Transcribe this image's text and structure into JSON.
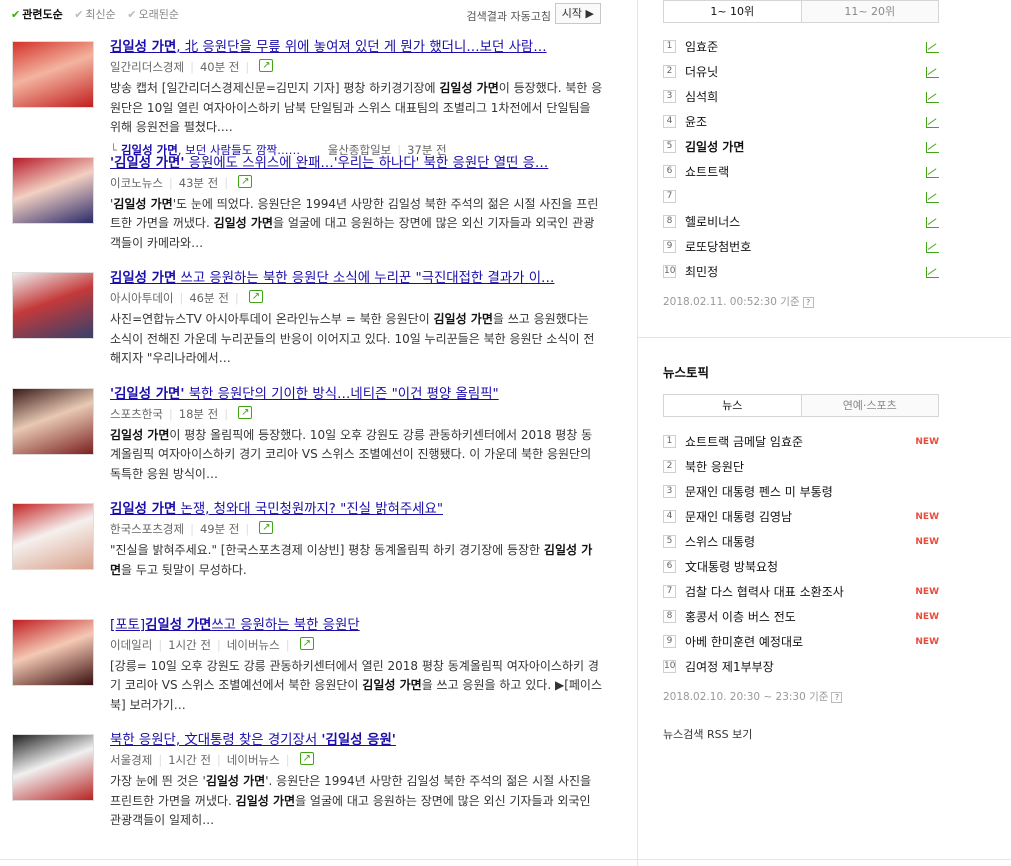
{
  "sort": {
    "options": [
      "관련도순",
      "최신순",
      "오래된순"
    ],
    "auto_label": "검색결과 자동고침",
    "start_label": "시작"
  },
  "articles": [
    {
      "title_parts": [
        {
          "t": "김일성 가면",
          "b": true
        },
        {
          "t": ", 北 응원단을 무릎 위에 놓여져 있던 게 뭔가 했더니…보던 사람…",
          "b": false
        }
      ],
      "source": "일간리더스경제",
      "time": "40분 전",
      "desc_parts": [
        {
          "t": "방송 캡처 [일간리더스경제신문=김민지 기자] 평창 하키경기장에 ",
          "b": false
        },
        {
          "t": "김일성 가면",
          "b": true
        },
        {
          "t": "이 등장했다. 북한 응원단은 10일 열린 여자아이스하키 남북 단일팀과 스위스 대표팀의 조별리그 1차전에서 단일팀을 위해 응원전을 펼쳤다.…",
          "b": false
        }
      ],
      "related": {
        "title_parts": [
          {
            "t": "김일성 가면",
            "b": true
          },
          {
            "t": ", 보던 사람들도 깜짝……",
            "b": false
          }
        ],
        "source": "울산종합일보",
        "time": "37분 전"
      }
    },
    {
      "title_parts": [
        {
          "t": "'김일성 가면'",
          "b": true
        },
        {
          "t": " 응원에도 스위스에 완패…'우리는 하나다' 북한 응원단 열띤 응…",
          "b": false
        }
      ],
      "source": "이코노뉴스",
      "time": "43분 전",
      "desc_parts": [
        {
          "t": "'",
          "b": false
        },
        {
          "t": "김일성 가면",
          "b": true
        },
        {
          "t": "'도 눈에 띄었다. 응원단은 1994년 사망한 김일성 북한 주석의 젊은 시절 사진을 프린트한 가면을 꺼냈다. ",
          "b": false
        },
        {
          "t": "김일성 가면",
          "b": true
        },
        {
          "t": "을 얼굴에 대고 응원하는 장면에 많은 외신 기자들과 외국인 관광객들이 카메라와…",
          "b": false
        }
      ]
    },
    {
      "title_parts": [
        {
          "t": "김일성 가면",
          "b": true
        },
        {
          "t": " 쓰고 응원하는 북한 응원단 소식에 누리꾼 \"극진대접한 결과가 이…",
          "b": false
        }
      ],
      "source": "아시아투데이",
      "time": "46분 전",
      "desc_parts": [
        {
          "t": "사진=연합뉴스TV 아시아투데이 온라인뉴스부 = 북한 응원단이 ",
          "b": false
        },
        {
          "t": "김일성 가면",
          "b": true
        },
        {
          "t": "을 쓰고 응원했다는 소식이 전해진 가운데 누리꾼들의 반응이 이어지고 있다. 10일 누리꾼들은 북한 응원단 소식이 전해지자 \"우리나라에서…",
          "b": false
        }
      ]
    },
    {
      "title_parts": [
        {
          "t": "'김일성 가면'",
          "b": true
        },
        {
          "t": " 북한 응원단의 기이한 방식…네티즌 \"이건 평양 올림픽\"",
          "b": false
        }
      ],
      "source": "스포츠한국",
      "time": "18분 전",
      "desc_parts": [
        {
          "t": "김일성 가면",
          "b": true
        },
        {
          "t": "이 평창 올림픽에 등장했다. 10일 오후 강원도 강릉 관동하키센터에서 2018 평창 동계올림픽 여자아이스하키 경기 코리아 VS 스위스 조별예선이 진행됐다. 이 가운데 북한 응원단의 독특한 응원 방식이…",
          "b": false
        }
      ]
    },
    {
      "title_parts": [
        {
          "t": "김일성 가면",
          "b": true
        },
        {
          "t": " 논쟁, 청와대 국민청원까지? \"진실 밝혀주세요\"",
          "b": false
        }
      ],
      "source": "한국스포츠경제",
      "time": "49분 전",
      "desc_parts": [
        {
          "t": "\"진실을 밝혀주세요.\" [한국스포츠경제 이상빈] 평창 동계올림픽 하키 경기장에 등장한 ",
          "b": false
        },
        {
          "t": "김일성 가면",
          "b": true
        },
        {
          "t": "을 두고 뒷말이 무성하다.",
          "b": false
        }
      ]
    },
    {
      "title_parts": [
        {
          "t": "[포토]",
          "b": false
        },
        {
          "t": "김일성 가면",
          "b": true
        },
        {
          "t": "쓰고 응원하는 북한 응원단",
          "b": false
        }
      ],
      "source": "이데일리",
      "time": "1시간 전",
      "extra": "네이버뉴스",
      "desc_parts": [
        {
          "t": "[강릉= 10일 오후 강원도 강릉 관동하키센터에서 열린 2018 평창 동계올림픽 여자아이스하키 경기 코리아 VS 스위스 조별예선에서 북한 응원단이 ",
          "b": false
        },
        {
          "t": "김일성 가면",
          "b": true
        },
        {
          "t": "을 쓰고 응원을 하고 있다. ▶[페이스북] 보러가기…",
          "b": false
        }
      ]
    },
    {
      "title_parts": [
        {
          "t": "북한 응원단, 文대통령 찾은 경기장서 ",
          "b": false
        },
        {
          "t": "'김일성 응원'",
          "b": true
        }
      ],
      "source": "서울경제",
      "time": "1시간 전",
      "extra": "네이버뉴스",
      "desc_parts": [
        {
          "t": "가장 눈에 띈 것은 '",
          "b": false
        },
        {
          "t": "김일성 가면",
          "b": true
        },
        {
          "t": "'. 응원단은 1994년 사망한 김일성 북한 주석의 젊은 시절 사진을 프린트한 가면을 꺼냈다. ",
          "b": false
        },
        {
          "t": "김일성 가면",
          "b": true
        },
        {
          "t": "을 얼굴에 대고 응원하는 장면에 많은 외신 기자들과 외국인 관광객들이 일제히…",
          "b": false
        }
      ]
    }
  ],
  "realtime": {
    "tabs": [
      "1~ 10위",
      "11~ 20위"
    ],
    "items": [
      "임효준",
      "더유닛",
      "심석희",
      "윤조",
      "김일성 가면",
      "쇼트트랙",
      "",
      "헬로비너스",
      "로또당첨번호",
      "최민정"
    ],
    "timestamp": "2018.02.11.  00:52:30 기준"
  },
  "topic": {
    "title": "뉴스토픽",
    "tabs": [
      "뉴스",
      "연예·스포츠"
    ],
    "items": [
      {
        "kw": "쇼트트랙 금메달 임효준",
        "new": true
      },
      {
        "kw": "북한 응원단",
        "new": false
      },
      {
        "kw": "문재인 대통령 펜스 미 부통령",
        "new": false
      },
      {
        "kw": "문재인 대통령 김영남",
        "new": true
      },
      {
        "kw": "스위스 대통령",
        "new": true
      },
      {
        "kw": "文대통령 방북요청",
        "new": false
      },
      {
        "kw": "검찰 다스 협력사 대표 소환조사",
        "new": true
      },
      {
        "kw": "홍콩서 이층 버스 전도",
        "new": true
      },
      {
        "kw": "아베 한미훈련 예정대로",
        "new": true
      },
      {
        "kw": "김여정 제1부부장",
        "new": false
      }
    ],
    "new_label": "NEW",
    "timestamp": "2018.02.10.  20:30 ~ 23:30 기준"
  },
  "rss_label": "뉴스검색 RSS 보기",
  "icons": {
    "check": "check-icon",
    "share": "share-icon",
    "trend": "trend-up-icon",
    "help": "help-icon",
    "play": "play-icon"
  }
}
